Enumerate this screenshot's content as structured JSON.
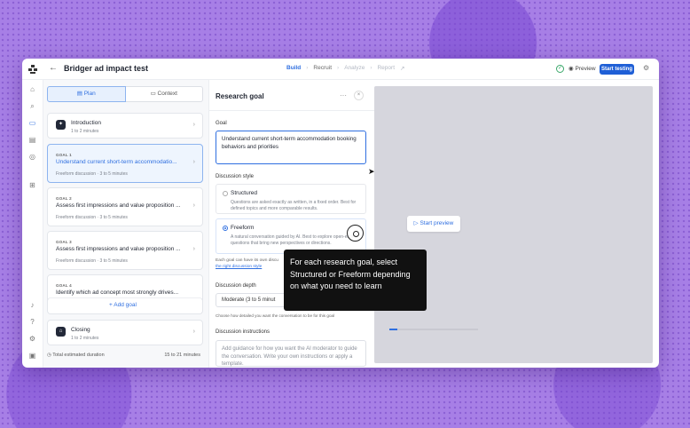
{
  "header": {
    "project_title": "Bridger ad impact test",
    "steps": [
      "Build",
      "Recruit",
      "Analyze",
      "Report"
    ],
    "preview_label": "Preview",
    "start_label": "Start testing"
  },
  "plan": {
    "tabs": {
      "plan": "Plan",
      "context": "Context"
    },
    "intro": {
      "title": "Introduction",
      "duration": "1 to 2 minutes"
    },
    "goals": [
      {
        "label": "GOAL 1",
        "title": "Understand current short-term accommodatio...",
        "meta": "Freeform discussion · 3 to 5 minutes"
      },
      {
        "label": "GOAL 2",
        "title": "Assess first impressions and value proposition ...",
        "meta": "Freeform discussion · 3 to 5 minutes"
      },
      {
        "label": "GOAL 3",
        "title": "Assess first impressions and value proposition ...",
        "meta": "Freeform discussion · 3 to 5 minutes"
      },
      {
        "label": "GOAL 4",
        "title": "Identify which ad concept most strongly drives..."
      }
    ],
    "add_goal": "+ Add goal",
    "closing": {
      "title": "Closing",
      "duration": "1 to 2 minutes"
    },
    "total_label": "Total estimated duration",
    "total_value": "15 to 21 minutes"
  },
  "goal_panel": {
    "title": "Research goal",
    "goal_label": "Goal",
    "goal_text": "Understand current short-term accommodation booking behaviors and priorities",
    "style_label": "Discussion style",
    "structured": {
      "title": "Structured",
      "desc": "Questions are asked exactly as written, in a fixed order. Best for defined topics and more comparable results."
    },
    "freeform": {
      "title": "Freeform",
      "desc": "A natural conversation guided by AI. Best to explore open-ended questions that bring new perspectives or directions."
    },
    "note_a": "Each goal can have its own discu",
    "note_b": "the right discussion style",
    "depth_label": "Discussion depth",
    "depth_value": "Moderate (3 to 5 minut",
    "depth_help": "Choose how detailed you want the conversation to be for this goal",
    "instructions_label": "Discussion instructions",
    "instructions_placeholder": "Add guidance for how you want the AI moderator to guide the conversation. Write your own instructions or apply a template."
  },
  "preview": {
    "start_preview": "Start preview",
    "progress_fraction": 0.09
  },
  "tooltip": {
    "text": "For each research goal, select Structured or Freeform depending on what you need to learn"
  },
  "colors": {
    "accent": "#2f6fe0",
    "primary_button": "#1f5fd6",
    "background": "#a77fe6"
  }
}
